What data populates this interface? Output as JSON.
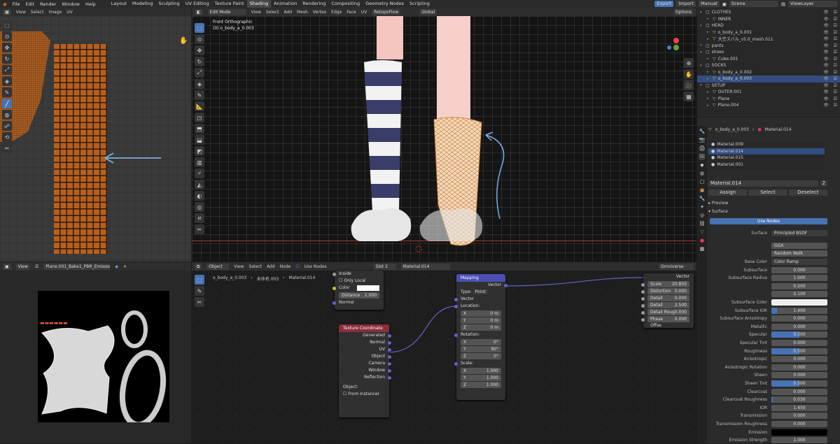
{
  "topbar": {
    "menus": [
      "File",
      "Edit",
      "Render",
      "Window",
      "Help"
    ],
    "workspaces": [
      "Layout",
      "Modeling",
      "Sculpting",
      "UV Editing",
      "Texture Paint",
      "Shading",
      "Animation",
      "Rendering",
      "Compositing",
      "Geometry Nodes",
      "Scripting"
    ],
    "active_ws": "Shading",
    "export": "Export",
    "import": "Import",
    "manual": "Manual",
    "scene": "Scene",
    "viewlayer": "ViewLayer"
  },
  "uv": {
    "menus": [
      "View",
      "Select",
      "Image",
      "UV"
    ]
  },
  "img": {
    "view": "View",
    "name": "Plane.001_Bake1_PBR_Emission"
  },
  "vp": {
    "mode": "Edit Mode",
    "menus": [
      "View",
      "Select",
      "Add",
      "Mesh",
      "Vertex",
      "Edge",
      "Face",
      "UV"
    ],
    "retopo": "RetopoFlow",
    "orient": "Global",
    "options": "Options",
    "view_name": "Front Orthographic",
    "obj_name": "(0) o_body_a_0.003"
  },
  "ne": {
    "type": "Object",
    "menus": [
      "View",
      "Select",
      "Add",
      "Node"
    ],
    "use_nodes": "Use Nodes",
    "slot": "Slot 2",
    "material": "Material.014",
    "render": "Omniverse",
    "bc_obj": "o_body_a_0.003",
    "bc_mesh": "未命名.003",
    "bc_mat": "Material.014"
  },
  "nodeA": {
    "rows": [
      "Inside",
      "Only Local",
      "Color",
      "Distance",
      "Normal"
    ],
    "distance": "1.000"
  },
  "texco": {
    "title": "Texture Coordinate",
    "outs": [
      "Generated",
      "Normal",
      "UV",
      "Object",
      "Camera",
      "Window",
      "Reflection"
    ],
    "object_label": "Object:",
    "from_inst": "From Instancer"
  },
  "mapping": {
    "title": "Mapping",
    "out": "Vector",
    "type_label": "Type:",
    "type": "Point",
    "vector": "Vector",
    "loc": "Location:",
    "rot": "Rotation:",
    "scale": "Scale:",
    "loc_vals": [
      [
        "X",
        "0 m"
      ],
      [
        "Y",
        "0 m"
      ],
      [
        "Z",
        "0 m"
      ]
    ],
    "rot_vals": [
      [
        "X",
        "0°"
      ],
      [
        "Y",
        "90°"
      ],
      [
        "Z",
        "0°"
      ]
    ],
    "scale_vals": [
      [
        "X",
        "1.000"
      ],
      [
        "Y",
        "1.000"
      ],
      [
        "Z",
        "1.000"
      ]
    ]
  },
  "noise": {
    "out": "Vector",
    "rows": [
      [
        "Scale",
        "20.850"
      ],
      [
        "Distortion",
        "0.000"
      ],
      [
        "Detail",
        "0.000"
      ],
      [
        "Detail Scale",
        "2.500"
      ],
      [
        "Detail Roug",
        "0.000"
      ],
      [
        "Phase Offse",
        "0.000"
      ]
    ]
  },
  "outliner": {
    "rows": [
      {
        "t": "CLOTHES",
        "d": 0,
        "c": "#ccc"
      },
      {
        "t": "INNER",
        "d": 1,
        "c": "#e6a35a"
      },
      {
        "t": "HEAD",
        "d": 0,
        "c": "#ccc"
      },
      {
        "t": "o_body_a_0.001",
        "d": 1,
        "c": "#e6a35a"
      },
      {
        "t": "大空スバル_v5.0_mesh.011",
        "d": 1,
        "c": "#e6a35a"
      },
      {
        "t": "pants",
        "d": 0,
        "c": "#ccc"
      },
      {
        "t": "shoes",
        "d": 0,
        "c": "#ccc"
      },
      {
        "t": "Cube.001",
        "d": 1,
        "c": "#e6a35a"
      },
      {
        "t": "SOCKS",
        "d": 0,
        "c": "#ccc"
      },
      {
        "t": "o_body_a_0.002",
        "d": 1,
        "c": "#e6a35a"
      },
      {
        "t": "o_body_a_0.003",
        "d": 1,
        "c": "#e6a35a",
        "sel": true
      },
      {
        "t": "SETUP",
        "d": 0,
        "c": "#ccc"
      },
      {
        "t": "OUTER.001",
        "d": 1,
        "c": "#e6a35a"
      },
      {
        "t": "Plane",
        "d": 1,
        "c": "#e6a35a"
      },
      {
        "t": "Plane.004",
        "d": 1,
        "c": "#e6a35a"
      }
    ]
  },
  "props": {
    "obj": "o_body_a_0.003",
    "mat": "Material.014",
    "slots": [
      "Material.009",
      "Material.014",
      "Material.015",
      "Material.001"
    ],
    "active_slot": 1,
    "matname": "Material.014",
    "matusers": "2",
    "assign": "Assign",
    "select": "Select",
    "deselect": "Deselect",
    "preview": "Preview",
    "surface_panel": "Surface",
    "use_nodes": "Use Nodes",
    "surface_label": "Surface",
    "surface_val": "Principled BSDF",
    "ggx": "GGX",
    "random_walk": "Random Walk",
    "base_color_label": "Base Color",
    "base_color_val": "Color Ramp",
    "rows": [
      {
        "l": "Subsurface",
        "v": "0.000",
        "f": 0
      },
      {
        "l": "Subsurface Radius",
        "v": "1.000",
        "f": 0
      },
      {
        "l": "",
        "v": "0.200",
        "f": 0
      },
      {
        "l": "",
        "v": "0.100",
        "f": 0
      },
      {
        "l": "Subsurface Color",
        "v": "",
        "f": 0,
        "white": true
      },
      {
        "l": "Subsurface IOR",
        "v": "1.400",
        "f": 0.1
      },
      {
        "l": "Subsurface Anisotropy",
        "v": "0.000",
        "f": 0
      },
      {
        "l": "Metallic",
        "v": "0.000",
        "f": 0
      },
      {
        "l": "Specular",
        "v": "0.500",
        "f": 0.5
      },
      {
        "l": "Specular Tint",
        "v": "0.000",
        "f": 0
      },
      {
        "l": "Roughness",
        "v": "0.500",
        "f": 0.5
      },
      {
        "l": "Anisotropic",
        "v": "0.000",
        "f": 0
      },
      {
        "l": "Anisotropic Rotation",
        "v": "0.000",
        "f": 0
      },
      {
        "l": "Sheen",
        "v": "0.000",
        "f": 0
      },
      {
        "l": "Sheen Tint",
        "v": "0.500",
        "f": 0.5
      },
      {
        "l": "Clearcoat",
        "v": "0.000",
        "f": 0
      },
      {
        "l": "Clearcoat Roughness",
        "v": "0.030",
        "f": 0.03
      },
      {
        "l": "IOR",
        "v": "1.450",
        "f": 0
      },
      {
        "l": "Transmission",
        "v": "0.000",
        "f": 0
      },
      {
        "l": "Transmission Roughness",
        "v": "0.000",
        "f": 0
      },
      {
        "l": "Emission",
        "v": "",
        "f": 0,
        "black": true
      },
      {
        "l": "Emission Strength",
        "v": "1.000",
        "f": 0
      }
    ]
  }
}
